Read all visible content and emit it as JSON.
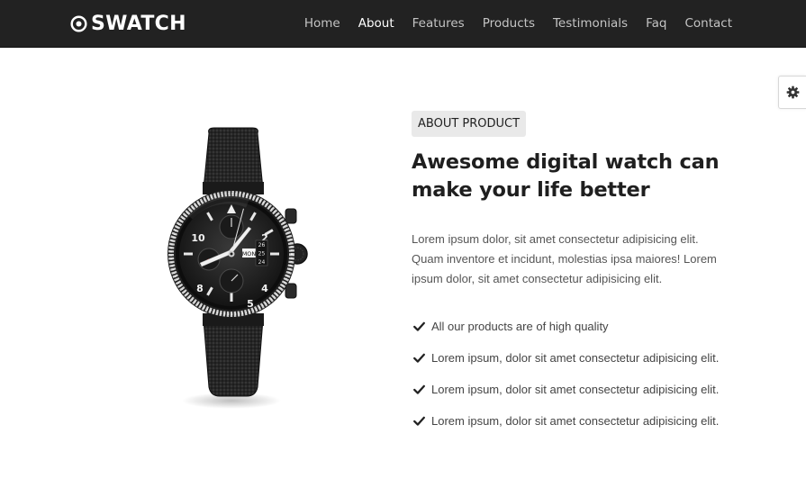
{
  "brand": {
    "name": "SWATCH",
    "icon": "target-logo-icon"
  },
  "nav": {
    "items": [
      {
        "label": "Home",
        "active": false
      },
      {
        "label": "About",
        "active": true
      },
      {
        "label": "Features",
        "active": false
      },
      {
        "label": "Products",
        "active": false
      },
      {
        "label": "Testimonials",
        "active": false
      },
      {
        "label": "Faq",
        "active": false
      },
      {
        "label": "Contact",
        "active": false
      }
    ]
  },
  "settings": {
    "icon": "gear-icon"
  },
  "about": {
    "badge": "ABOUT PRODUCT",
    "heading": "Awesome digital watch can make your life better",
    "description": "Lorem ipsum dolor, sit amet consectetur adipisicing elit. Quam inventore et incidunt, molestias ipsa maiores! Lorem ipsum dolor, sit amet consectetur adipisicing elit.",
    "features": [
      "All our products are of high quality",
      "Lorem ipsum, dolor sit amet consectetur adipisicing elit.",
      "Lorem ipsum, dolor sit amet consectetur adipisicing elit.",
      "Lorem ipsum, dolor sit amet consectetur adipisicing elit."
    ],
    "watch_dial": {
      "day": "MON",
      "date_top": "26",
      "date_mid": "25",
      "date_bottom": "24",
      "numbers": [
        "10",
        "2",
        "4",
        "5",
        "8"
      ]
    }
  },
  "colors": {
    "navbar_bg": "#222222",
    "nav_active": "#ffffff",
    "nav_inactive": "#c4c4c4",
    "badge_bg": "#e9e9e9",
    "accent_red": "#d42a1f"
  }
}
